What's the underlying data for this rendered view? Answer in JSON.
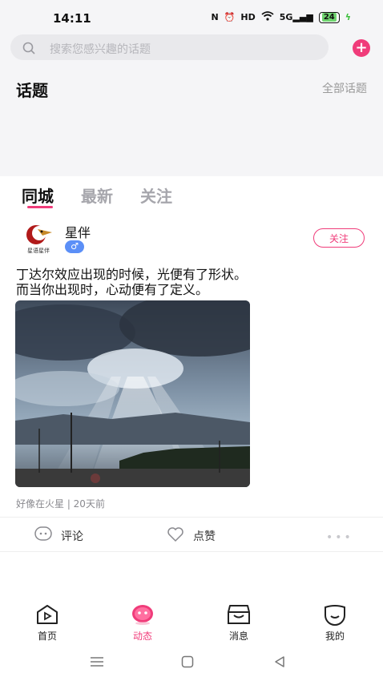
{
  "status": {
    "time": "14:11",
    "network": "5G",
    "battery": "24"
  },
  "search": {
    "placeholder": "搜索您感兴趣的话题"
  },
  "topics": {
    "title": "话题",
    "all_label": "全部话题"
  },
  "tabs": [
    "同城",
    "最新",
    "关注"
  ],
  "post": {
    "username": "星伴",
    "avatar_caption": "星语星伴",
    "follow_label": "关注",
    "text_line1": "丁达尔效应出现的时候，光便有了形状。",
    "text_line2": "而当你出现时，心动便有了定义。",
    "meta": "好像在火星 | 20天前",
    "comment_label": "评论",
    "like_label": "点赞"
  },
  "nav": {
    "home": "首页",
    "feed": "动态",
    "messages": "消息",
    "me": "我的"
  },
  "colors": {
    "accent": "#f03c7a",
    "gender_badge": "#5b8ff7",
    "background_gray": "#f5f5f7"
  }
}
